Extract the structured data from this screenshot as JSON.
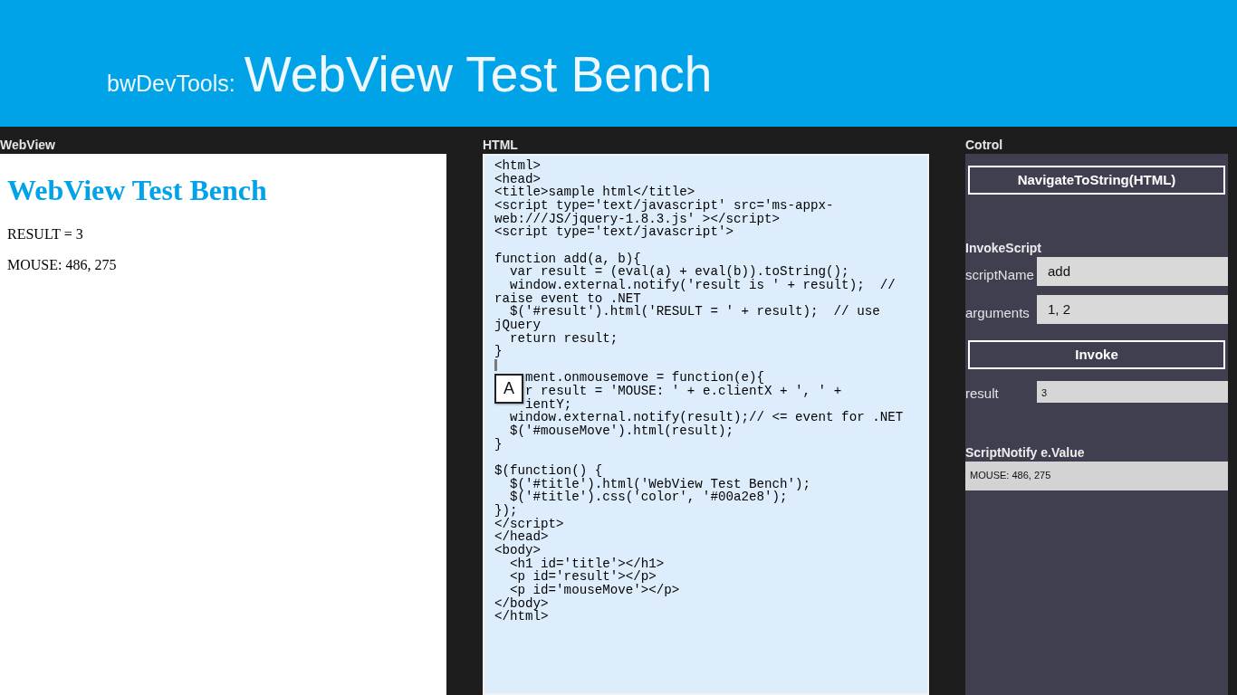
{
  "header": {
    "subtitle": "bwDevTools:",
    "title": "WebView Test Bench"
  },
  "webview": {
    "label": "WebView",
    "page": {
      "heading": "WebView Test Bench",
      "paragraphs": [
        "RESULT = 3",
        "MOUSE: 486, 275"
      ]
    }
  },
  "html_editor": {
    "label": "HTML",
    "blocks": [
      {
        "caret_below": false,
        "rows": [
          "<html>",
          "<head>",
          "<title>sample html</title>",
          "<script type='text/javascript' src='ms-appx-",
          "web:///JS/jquery-1.8.3.js' ></script>",
          "<script type='text/javascript'>"
        ]
      },
      {
        "caret_below": true,
        "rows": [
          "function add(a, b){",
          "  var result = (eval(a) + eval(b)).toString();",
          "  window.external.notify('result is ' + result);  //",
          "raise event to .NET",
          "  $('#result').html('RESULT = ' + result);  // use",
          "jQuery",
          "  return result;",
          "}"
        ]
      },
      {
        "caret_below": false,
        "input_indicator": {
          "label": "A"
        },
        "rows": [
          "ment.onmousemove = function(e){",
          "r result = 'MOUSE: ' + e.clientX + ', ' +",
          "ientY;",
          "  window.external.notify(result);// <= event for .NET",
          "  $('#mouseMove').html(result);",
          "}"
        ]
      },
      {
        "caret_below": false,
        "rows": [
          "$(function() {",
          "  $('#title').html('WebView Test Bench');",
          "  $('#title').css('color', '#00a2e8');",
          "});",
          "</script>",
          "</head>",
          "<body>",
          "  <h1 id='title'></h1>",
          "  <p id='result'></p>",
          "  <p id='mouseMove'></p>",
          "</body>",
          "</html>"
        ]
      }
    ]
  },
  "control": {
    "label": "Cotrol",
    "navigate_button": "NavigateToString(HTML)",
    "invoke_script": {
      "heading": "InvokeScript",
      "inputs": [
        {
          "label": "scriptName",
          "value": "add"
        },
        {
          "label": "arguments",
          "value": "1, 2"
        }
      ],
      "invoke_button": "Invoke",
      "result": {
        "label": "result",
        "value": "3"
      }
    },
    "script_notify": {
      "heading": "ScriptNotify e.Value",
      "value": "MOUSE: 486, 275"
    }
  }
}
